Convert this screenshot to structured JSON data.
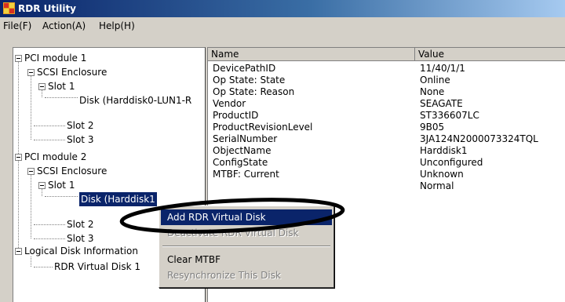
{
  "window": {
    "title": "RDR Utility",
    "icon": "rdr-app-icon",
    "titlebar_color": "#0a246a"
  },
  "menu": {
    "items": [
      "File(F)",
      "Action(A)",
      "Help(H)"
    ]
  },
  "tree": {
    "nodes": [
      "PCI module 1",
      "SCSI Enclosure",
      "Slot 1",
      "Disk (Harddisk0-LUN1-R",
      "Slot 2",
      "Slot 3",
      "PCI module 2",
      "SCSI Enclosure",
      "Slot 1",
      "Disk (Harddisk1",
      "Slot 2",
      "Slot 3",
      "Logical Disk Information",
      "RDR Virtual Disk 1"
    ]
  },
  "list": {
    "columns": [
      "Name",
      "Value"
    ],
    "rows": [
      [
        "DevicePathID",
        "11/40/1/1"
      ],
      [
        "Op State: State",
        "Online"
      ],
      [
        "Op State: Reason",
        "None"
      ],
      [
        "Vendor",
        "SEAGATE"
      ],
      [
        "ProductID",
        "ST336607LC"
      ],
      [
        "ProductRevisionLevel",
        "9B05"
      ],
      [
        "SerialNumber",
        "3JA124N2000073324TQL"
      ],
      [
        "ObjectName",
        "Harddisk1"
      ],
      [
        "ConfigState",
        "Unconfigured"
      ],
      [
        "MTBF: Current",
        "Unknown"
      ],
      [
        "",
        "Normal"
      ]
    ]
  },
  "context_menu": {
    "items": [
      {
        "label": "Add RDR Virtual Disk",
        "state": "highlighted"
      },
      {
        "label": "Deactivate RDR Virtual Disk",
        "state": "disabled"
      },
      {
        "label": "Clear MTBF",
        "state": "enabled"
      },
      {
        "label": "Resynchronize This Disk",
        "state": "disabled"
      }
    ],
    "highlight_color": "#0a246a"
  },
  "annotation": {
    "shape": "ellipse",
    "color": "#000000"
  }
}
